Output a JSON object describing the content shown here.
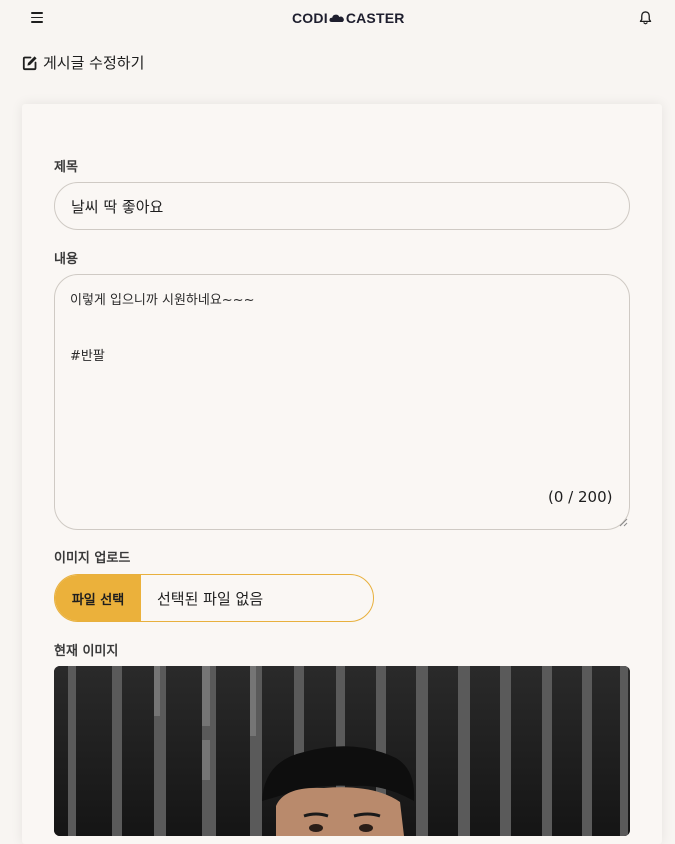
{
  "header": {
    "logo_left": "CODI",
    "logo_right": "CASTER",
    "menu_icon": "hamburger-menu-icon",
    "bell_icon": "bell-icon"
  },
  "page": {
    "heading": "게시글 수정하기",
    "heading_icon": "edit-icon"
  },
  "form": {
    "title_label": "제목",
    "title_value": "날씨 딱 좋아요",
    "content_label": "내용",
    "content_line1": "이렇게 입으니까 시원하네요~~~",
    "content_line2": "#반팔",
    "char_counter": "(0 / 200)",
    "upload_label": "이미지 업로드",
    "file_button": "파일 선택",
    "file_status": "선택된 파일 없음",
    "current_image_label": "현재 이미지"
  },
  "colors": {
    "background": "#f8f5f2",
    "accent": "#ebb13b",
    "border": "#cfcac4"
  }
}
